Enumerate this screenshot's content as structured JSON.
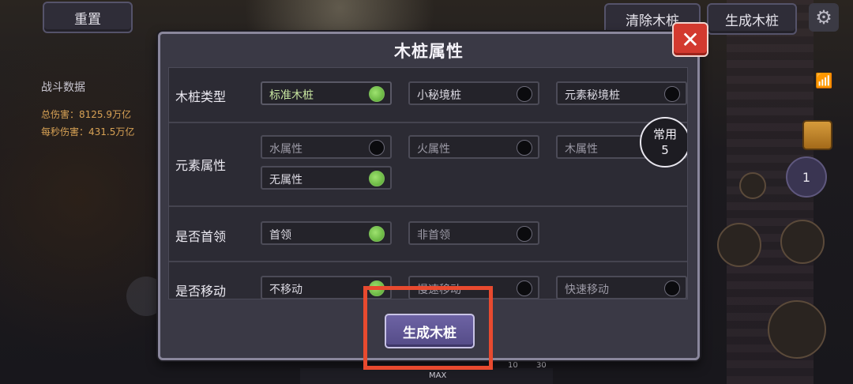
{
  "top_bar": {
    "reset_label": "重置",
    "clear_label": "清除木桩",
    "generate_label": "生成木桩"
  },
  "battle": {
    "title": "战斗数据",
    "total_damage": "总伤害：8125.9万亿",
    "dps": "每秒伤害：431.5万亿"
  },
  "hud": {
    "level_badge": "1",
    "max_label": "MAX",
    "count_a": "10",
    "count_b": "30"
  },
  "dialog": {
    "title": "木桩属性",
    "close_label": "✕",
    "favorite_badge_line1": "常用",
    "favorite_badge_line2": "5",
    "generate_label": "生成木桩",
    "rows": {
      "type": {
        "label": "木桩类型",
        "options": [
          {
            "label": "标准木桩",
            "selected": true
          },
          {
            "label": "小秘境桩",
            "selected": false
          },
          {
            "label": "元素秘境桩",
            "selected": false
          }
        ]
      },
      "element": {
        "label": "元素属性",
        "options": [
          {
            "label": "水属性",
            "selected": false
          },
          {
            "label": "火属性",
            "selected": false
          },
          {
            "label": "木属性",
            "selected": false
          },
          {
            "label": "无属性",
            "selected": true
          }
        ]
      },
      "boss": {
        "label": "是否首领",
        "options": [
          {
            "label": "首领",
            "selected": true
          },
          {
            "label": "非首领",
            "selected": false
          }
        ]
      },
      "moving": {
        "label": "是否移动",
        "options": [
          {
            "label": "不移动",
            "selected": true
          },
          {
            "label": "慢速移动",
            "selected": false
          },
          {
            "label": "快速移动",
            "selected": false
          }
        ]
      }
    }
  },
  "colors": {
    "highlight": "#e84a2f",
    "selected_radio": "#7cbf58",
    "close_button": "#d33a2f",
    "generate_button": "#6d63a4"
  }
}
